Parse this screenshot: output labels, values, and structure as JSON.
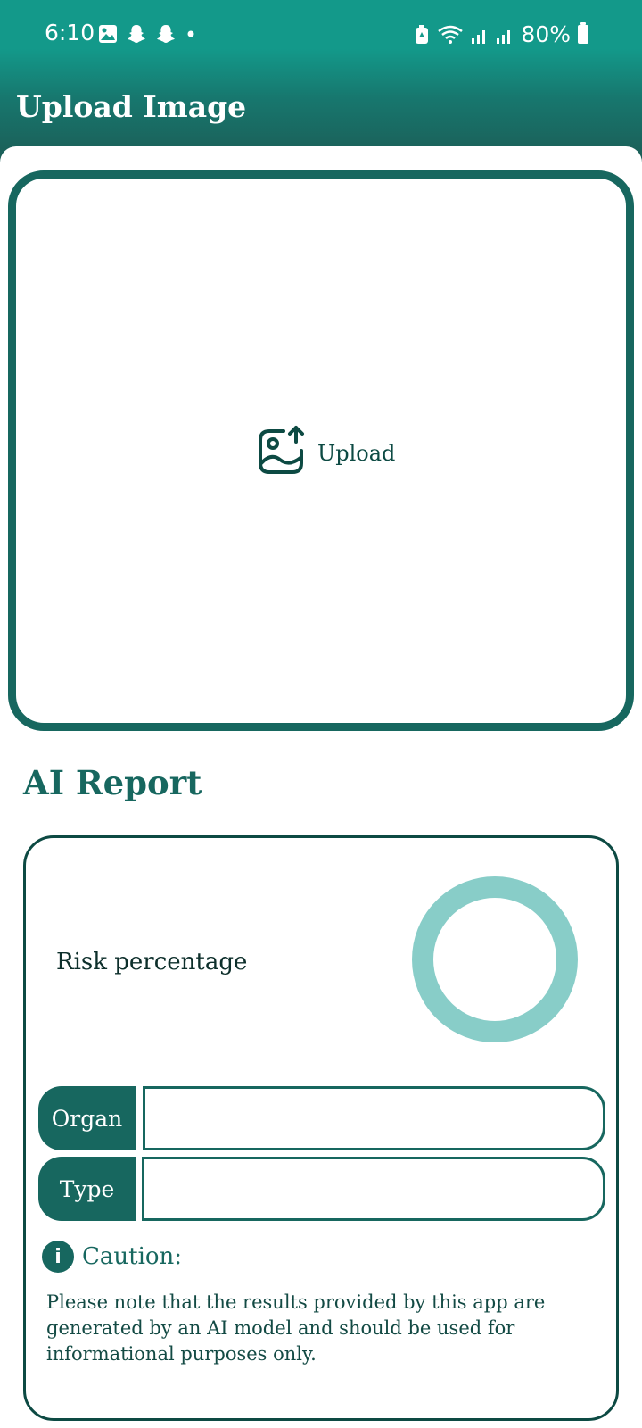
{
  "status_bar": {
    "time": "6:10",
    "battery": "80%",
    "left_icons": [
      "gallery-icon",
      "snapchat-icon",
      "snapchat-icon",
      "dot-icon"
    ],
    "right_icons": [
      "battery-saver-icon",
      "wifi-icon",
      "signal-icon",
      "signal-icon"
    ]
  },
  "header": {
    "title": "Upload Image",
    "color": "#17776e"
  },
  "upload": {
    "label": "Upload",
    "icon": "image-upload-icon",
    "border_color": "#17675f"
  },
  "report": {
    "title": "AI Report",
    "risk_label": "Risk percentage",
    "risk_ring_color": "#88cdc8",
    "fields": {
      "organ_label": "Organ",
      "organ_value": "",
      "type_label": "Type",
      "type_value": ""
    },
    "caution": {
      "title": "Caution:",
      "icon": "info-icon",
      "text": "Please note that the results provided by this app are generated by an AI model and should be used for informational purposes only."
    }
  }
}
